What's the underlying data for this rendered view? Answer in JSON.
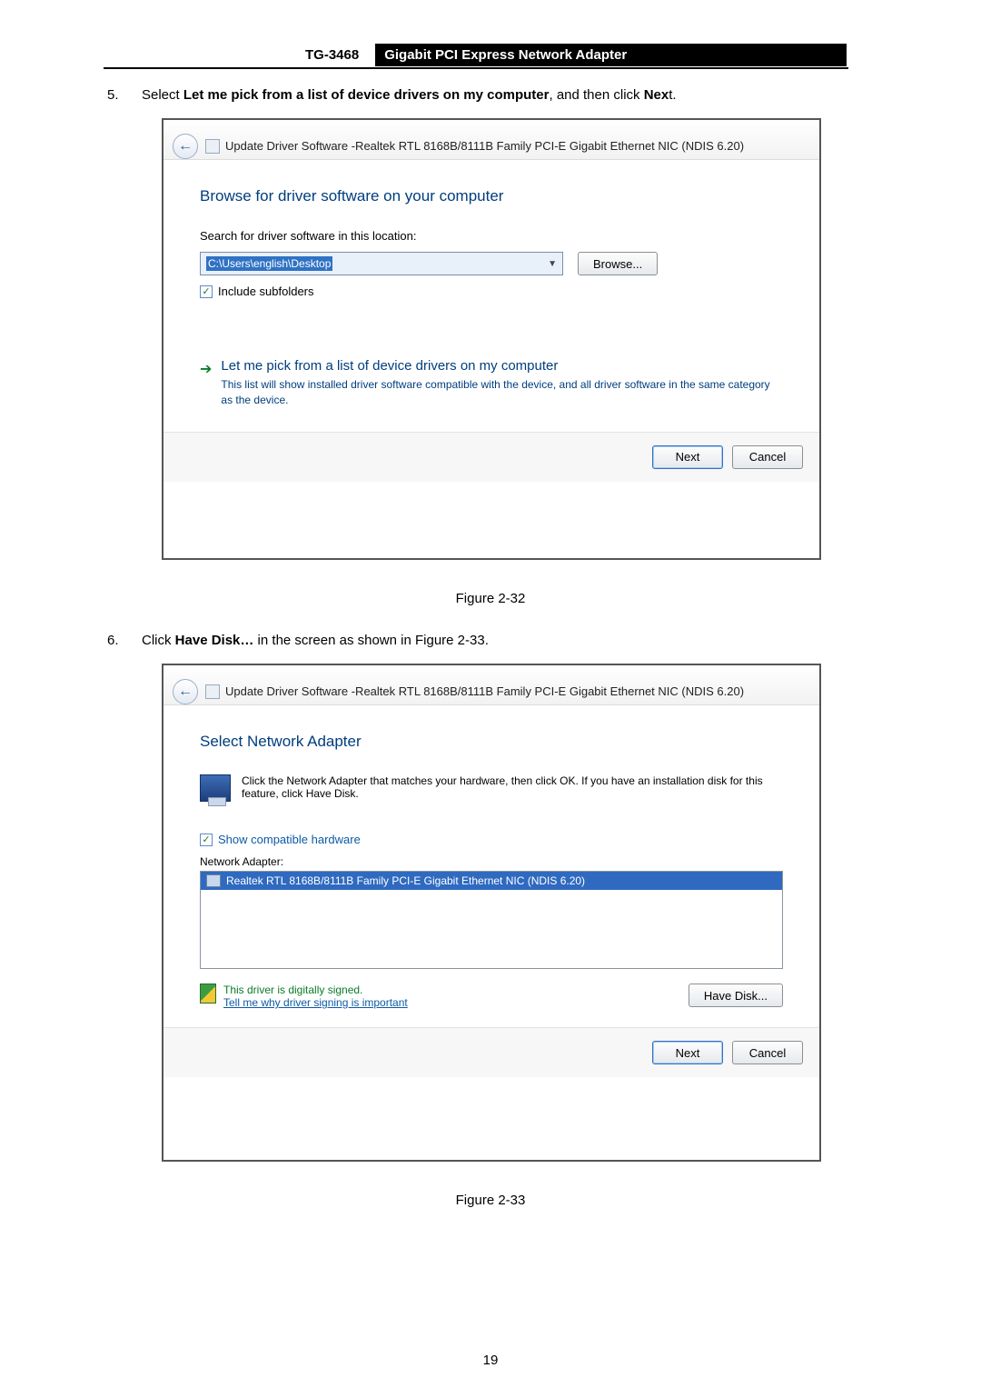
{
  "header": {
    "label": "TG-3468",
    "title": "Gigabit PCI Express Network Adapter"
  },
  "step5": {
    "num": "5.",
    "prefix": "Select ",
    "bold1": "Let me pick from a list of device drivers on my computer",
    "mid": ", and then click ",
    "bold2": "Nex",
    "suffix": "t."
  },
  "dialog1": {
    "title": "Update Driver Software -Realtek RTL 8168B/8111B Family PCI-E Gigabit Ethernet NIC (NDIS 6.20)",
    "heading": "Browse for driver software on your computer",
    "search_label": "Search for driver software in this location:",
    "path": "C:\\Users\\english\\Desktop",
    "browse": "Browse...",
    "include": "Include subfolders",
    "pick_title": "Let me pick from a list of device drivers on my computer",
    "pick_sub": "This list will show installed driver software compatible with the device, and all driver software in the same category as the device.",
    "next": "Next",
    "cancel": "Cancel"
  },
  "figure1": "Figure 2-32",
  "step6": {
    "num": "6.",
    "prefix": "Click ",
    "bold1": "Have Disk…",
    "suffix": " in the screen as shown in Figure 2-33."
  },
  "dialog2": {
    "title": "Update Driver Software -Realtek RTL 8168B/8111B Family PCI-E Gigabit Ethernet NIC (NDIS 6.20)",
    "heading": "Select Network Adapter",
    "instruction": "Click the Network Adapter that matches your hardware, then click OK. If you have an installation disk for this feature, click Have Disk.",
    "show_compat": "Show compatible hardware",
    "list_header": "Network Adapter:",
    "list_item": "Realtek RTL 8168B/8111B Family PCI-E Gigabit Ethernet NIC (NDIS 6.20)",
    "signed": "This driver is digitally signed.",
    "tell_me": "Tell me why driver signing is important",
    "have_disk": "Have Disk...",
    "next": "Next",
    "cancel": "Cancel"
  },
  "figure2": "Figure 2-33",
  "page_number": "19"
}
